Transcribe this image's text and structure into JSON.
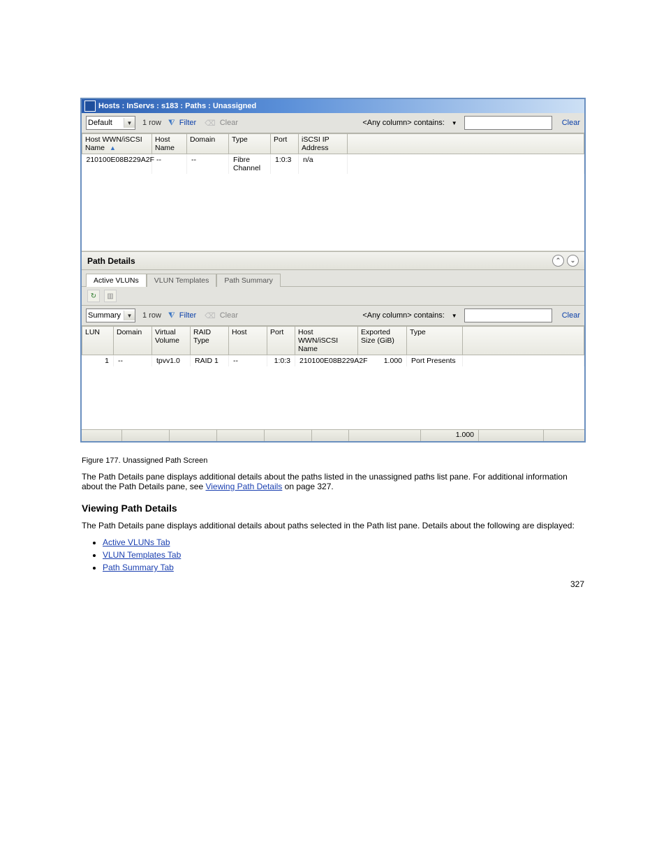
{
  "window": {
    "title": "Hosts : InServs : s183 : Paths : Unassigned"
  },
  "topToolbar": {
    "viewSelect": "Default",
    "rowCount": "1 row",
    "filterLabel": "Filter",
    "clearLabel": "Clear",
    "searchScope": "<Any column> contains:",
    "searchClear": "Clear"
  },
  "topHeaders": {
    "hostWwn": "Host WWN/iSCSI Name",
    "hostName": "Host Name",
    "domain": "Domain",
    "type": "Type",
    "port": "Port",
    "iscsiIp": "iSCSI IP Address"
  },
  "topRow": {
    "hostWwn": "210100E08B229A2F",
    "hostName": "--",
    "domain": "--",
    "type": "Fibre Channel",
    "port": "1:0:3",
    "iscsiIp": "n/a"
  },
  "pathDetails": {
    "title": "Path Details"
  },
  "tabs": {
    "active": "Active VLUNs",
    "vlunTemplates": "VLUN Templates",
    "pathSummary": "Path Summary"
  },
  "detailToolbar": {
    "viewSelect": "Summary",
    "rowCount": "1 row",
    "filterLabel": "Filter",
    "clearLabel": "Clear",
    "searchScope": "<Any column> contains:",
    "searchClear": "Clear"
  },
  "detailHeaders": {
    "lun": "LUN",
    "domain": "Domain",
    "vv": "Virtual Volume",
    "raid": "RAID Type",
    "host": "Host",
    "port": "Port",
    "wwn": "Host WWN/iSCSI Name",
    "exported": "Exported Size (GiB)",
    "vtype": "Type"
  },
  "detailRow": {
    "lun": "1",
    "domain": "--",
    "vv": "tpvv1.0",
    "raid": "RAID 1",
    "host": "--",
    "port": "1:0:3",
    "wwn": "210100E08B229A2F",
    "exported": "1.000",
    "vtype": "Port Presents"
  },
  "footer": {
    "total": "1.000"
  },
  "docText": {
    "caption": "Figure 177. Unassigned Path Screen",
    "para1a": "The Path Details pane displays additional details about the paths listed in the unassigned paths list pane. For additional information about the Path Details pane, see ",
    "para1link": "Viewing Path Details",
    "para1b": " on page 327.",
    "subhead": "Viewing Path Details",
    "para2": "The Path Details pane displays additional details about paths selected in the Path list pane. Details about the following are displayed:",
    "li1": "Active VLUNs Tab",
    "li2": "VLUN Templates Tab",
    "li3": "Path Summary Tab",
    "pageNum": "327"
  }
}
